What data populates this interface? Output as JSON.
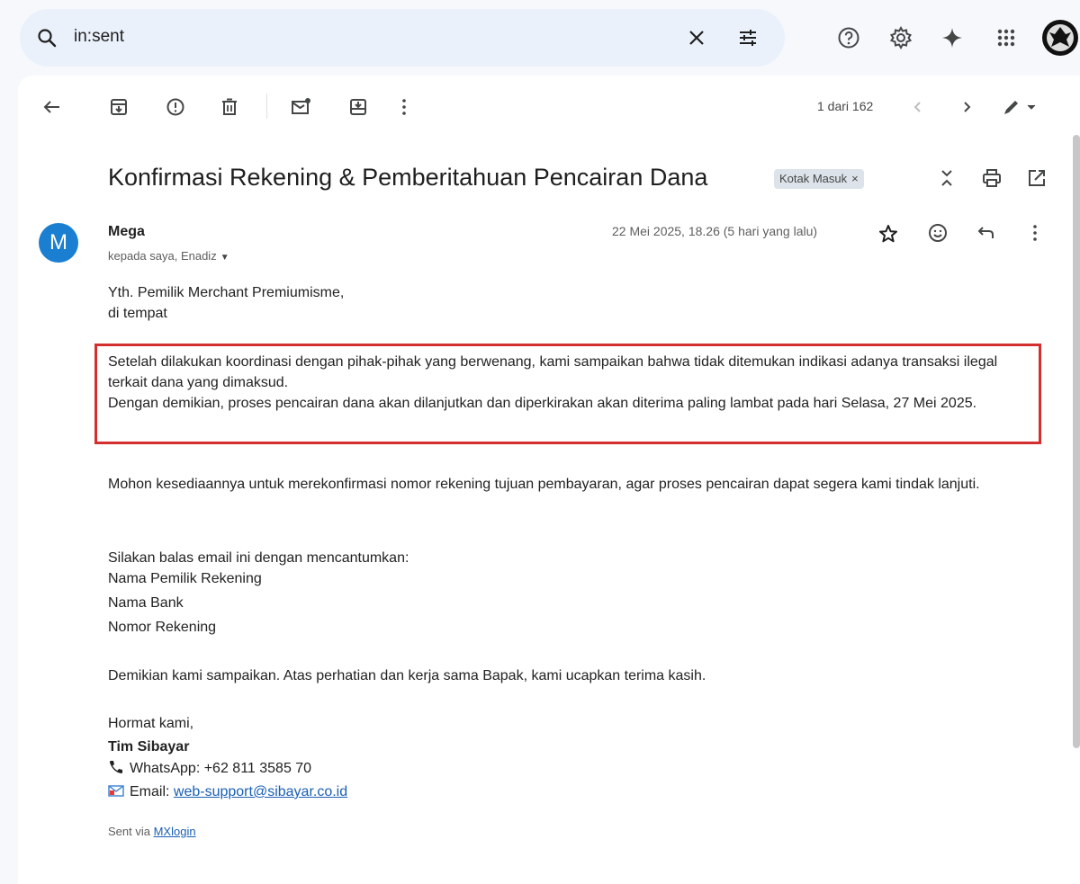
{
  "search": {
    "query": "in:sent"
  },
  "toolbar": {
    "pager": "1 dari 162"
  },
  "message": {
    "subject": "Konfirmasi Rekening & Pemberitahuan Pencairan Dana",
    "label": "Kotak Masuk",
    "label_remove": "×",
    "sender_initial": "M",
    "sender_name": "Mega",
    "recipients": "kepada saya, Enadiz",
    "date": "22 Mei 2025, 18.26 (5 hari yang lalu)",
    "greeting_1": "Yth. Pemilik Merchant Premiumisme,",
    "greeting_2": "di tempat",
    "highlight_1": "Setelah dilakukan koordinasi dengan pihak-pihak yang berwenang, kami sampaikan bahwa tidak ditemukan indikasi adanya transaksi ilegal terkait dana yang dimaksud.",
    "highlight_2": "Dengan demikian, proses pencairan dana akan dilanjutkan dan diperkirakan akan diterima paling lambat pada hari Selasa, 27 Mei 2025.",
    "para_confirm": "Mohon kesediaannya untuk merekonfirmasi nomor rekening tujuan pembayaran, agar proses pencairan dapat segera kami tindak lanjuti.",
    "instructions_title": "Silakan balas email ini dengan mencantumkan:",
    "fields": [
      "Nama Pemilik Rekening",
      "Nama Bank",
      "Nomor Rekening"
    ],
    "closing": "Demikian kami sampaikan. Atas perhatian dan kerja sama Bapak, kami ucapkan terima kasih.",
    "regards": "Hormat kami,",
    "team": "Tim Sibayar",
    "whatsapp": "WhatsApp: +62 811 3585 70",
    "email_label": "Email: ",
    "email_address": "web-support@sibayar.co.id",
    "sent_via_prefix": "Sent via ",
    "sent_via_link": "MXlogin"
  }
}
